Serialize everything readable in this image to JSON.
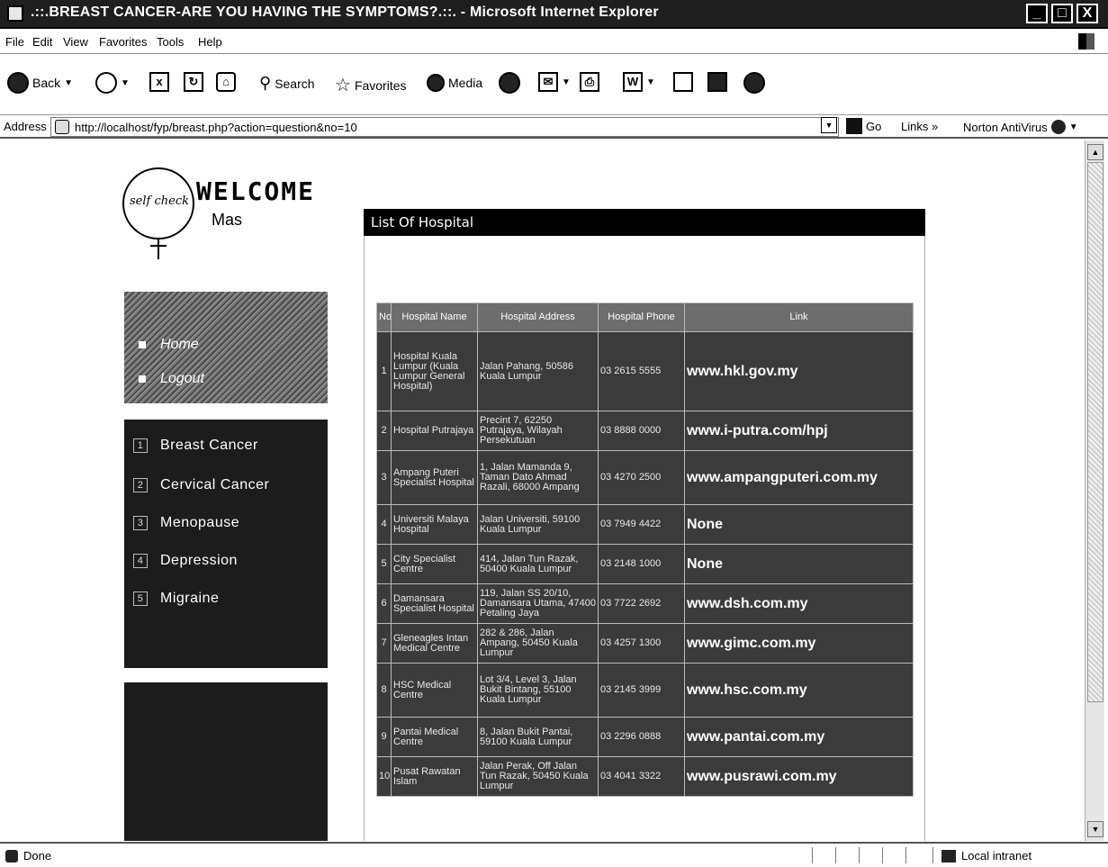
{
  "window": {
    "title": ".::.BREAST CANCER-ARE YOU HAVING THE SYMPTOMS?.::. - Microsoft Internet Explorer",
    "buttons": {
      "minimize": "_",
      "maximize": "□",
      "close": "X"
    }
  },
  "menubar": {
    "items": [
      "File",
      "Edit",
      "View",
      "Favorites",
      "Tools",
      "Help"
    ]
  },
  "toolbar": {
    "back": "Back",
    "search": "Search",
    "favorites": "Favorites",
    "media": "Media",
    "word_icon": "W"
  },
  "addressbar": {
    "label": "Address",
    "url": "http://localhost/fyp/breast.php?action=question&no=10",
    "go": "Go",
    "links": "Links",
    "links_chevron": "»",
    "norton": "Norton AntiVirus"
  },
  "sidebar": {
    "logo_text": "self check",
    "welcome": "WELCOME",
    "username": "Mas",
    "nav": [
      "Home",
      "Logout"
    ],
    "categories": [
      {
        "num": "1",
        "label": "Breast Cancer"
      },
      {
        "num": "2",
        "label": "Cervical Cancer"
      },
      {
        "num": "3",
        "label": "Menopause"
      },
      {
        "num": "4",
        "label": "Depression"
      },
      {
        "num": "5",
        "label": "Migraine"
      }
    ]
  },
  "main": {
    "header": "List Of Hospital",
    "columns": [
      "No",
      "Hospital Name",
      "Hospital Address",
      "Hospital Phone",
      "Link"
    ],
    "rows": [
      {
        "no": "1",
        "name": "Hospital Kuala Lumpur (Kuala Lumpur General Hospital)",
        "address": "Jalan Pahang, 50586 Kuala Lumpur",
        "phone": "03 2615 5555",
        "link": "www.hkl.gov.my"
      },
      {
        "no": "2",
        "name": "Hospital Putrajaya",
        "address": "Precint 7, 62250 Putrajaya, Wilayah Persekutuan",
        "phone": "03 8888 0000",
        "link": "www.i-putra.com/hpj"
      },
      {
        "no": "3",
        "name": "Ampang Puteri Specialist Hospital",
        "address": "1, Jalan Mamanda 9, Taman Dato Ahmad Razali, 68000 Ampang",
        "phone": "03 4270 2500",
        "link": "www.ampangputeri.com.my"
      },
      {
        "no": "4",
        "name": "Universiti Malaya Hospital",
        "address": "Jalan Universiti, 59100 Kuala Lumpur",
        "phone": "03 7949 4422",
        "link": "None"
      },
      {
        "no": "5",
        "name": "City Specialist Centre",
        "address": "414, Jalan Tun Razak, 50400 Kuala Lumpur",
        "phone": "03 2148 1000",
        "link": "None"
      },
      {
        "no": "6",
        "name": "Damansara Specialist Hospital",
        "address": "119, Jalan SS 20/10, Damansara Utama, 47400 Petaling Jaya",
        "phone": "03 7722 2692",
        "link": "www.dsh.com.my"
      },
      {
        "no": "7",
        "name": "Gleneagles Intan Medical Centre",
        "address": "282 & 286, Jalan Ampang, 50450 Kuala Lumpur",
        "phone": "03 4257 1300",
        "link": "www.gimc.com.my"
      },
      {
        "no": "8",
        "name": "HSC Medical Centre",
        "address": "Lot 3/4, Level 3, Jalan Bukit Bintang, 55100 Kuala Lumpur",
        "phone": "03 2145 3999",
        "link": "www.hsc.com.my"
      },
      {
        "no": "9",
        "name": "Pantai Medical Centre",
        "address": "8, Jalan Bukit Pantai, 59100 Kuala Lumpur",
        "phone": "03 2296 0888",
        "link": "www.pantai.com.my"
      },
      {
        "no": "10",
        "name": "Pusat Rawatan Islam",
        "address": "Jalan Perak, Off Jalan Tun Razak, 50450 Kuala Lumpur",
        "phone": "03 4041 3322",
        "link": "www.pusrawi.com.my"
      }
    ]
  },
  "statusbar": {
    "status": "Done",
    "zone": "Local intranet"
  }
}
